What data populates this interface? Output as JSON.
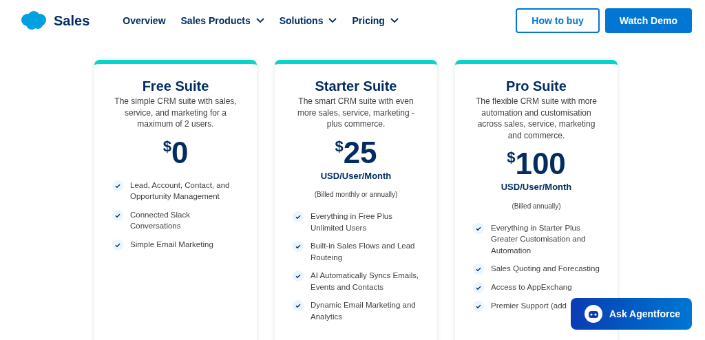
{
  "brand": {
    "name": "Sales"
  },
  "nav": [
    {
      "label": "Overview",
      "dropdown": false
    },
    {
      "label": "Sales Products",
      "dropdown": true
    },
    {
      "label": "Solutions",
      "dropdown": true
    },
    {
      "label": "Pricing",
      "dropdown": true
    }
  ],
  "actions": [
    {
      "label": "How to buy",
      "kind": "outline"
    },
    {
      "label": "Watch Demo",
      "kind": "solid"
    }
  ],
  "plans": [
    {
      "title": "Free Suite",
      "description": "The simple CRM suite with sales, service, and marketing for a maximum of 2 users.",
      "currency": "$",
      "price": "0",
      "features": [
        "Lead, Account, Contact, and Opportunity Management",
        "Connected Slack Conversations",
        "Simple Email Marketing"
      ]
    },
    {
      "title": "Starter Suite",
      "description": "The smart CRM suite with even more sales, service, marketing - plus commerce.",
      "currency": "$",
      "price": "25",
      "unit": "USD/User/Month",
      "billing": "(Billed monthly or annually)",
      "features": [
        "Everything in Free Plus Unlimited Users",
        "Built-in Sales Flows and Lead Routeing",
        "AI Automatically Syncs Emails, Events and Contacts",
        "Dynamic Email Marketing and Analytics"
      ]
    },
    {
      "title": "Pro Suite",
      "description": "The flexible CRM suite with more automation and customisation across sales, service, marketing and commerce.",
      "currency": "$",
      "price": "100",
      "unit": "USD/User/Month",
      "billing": "(Billed annually)",
      "features": [
        "Everything in Starter Plus Greater Customisation and Automation",
        "Sales Quoting and Forecasting",
        "Access to AppExchang",
        "Premier Support (add"
      ]
    }
  ],
  "assistant": {
    "label": "Ask Agentforce"
  }
}
